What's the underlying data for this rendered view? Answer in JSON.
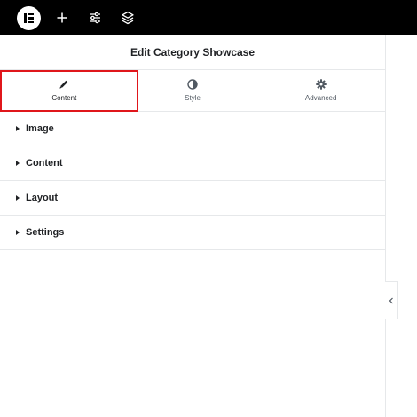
{
  "topbar": {
    "logo_icon": "elementor-logo-icon",
    "tools": [
      {
        "name": "add-element-icon"
      },
      {
        "name": "site-settings-icon"
      },
      {
        "name": "structure-layers-icon"
      }
    ]
  },
  "panel": {
    "title": "Edit Category Showcase",
    "tabs": [
      {
        "label": "Content",
        "icon": "pencil-icon",
        "active": true
      },
      {
        "label": "Style",
        "icon": "half-circle-icon",
        "active": false
      },
      {
        "label": "Advanced",
        "icon": "gear-icon",
        "active": false
      }
    ],
    "sections": [
      {
        "label": "Image"
      },
      {
        "label": "Content"
      },
      {
        "label": "Layout"
      },
      {
        "label": "Settings"
      }
    ]
  },
  "colors": {
    "topbar": "#000000",
    "highlight": "#e0161b",
    "text": "#1f2124"
  }
}
